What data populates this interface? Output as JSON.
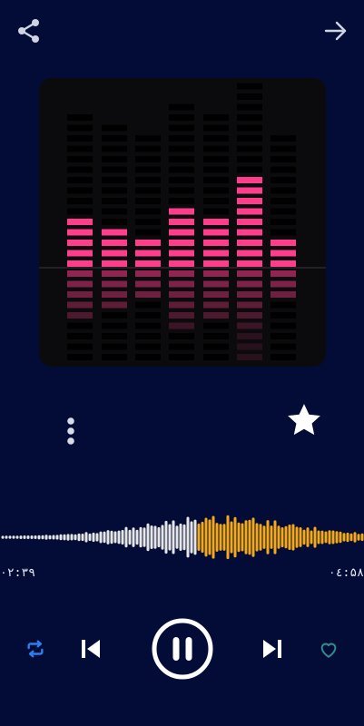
{
  "player": {
    "elapsed": "۰۲:۳۹",
    "duration": "۰٤:۵۸",
    "progress": 0.54
  },
  "icons": {
    "share": "share-icon",
    "forward": "arrow-right-icon",
    "more": "more-vertical-icon",
    "favorite": "star-icon",
    "repeat": "repeat-icon",
    "previous": "skip-previous-icon",
    "play_pause": "pause-icon",
    "next": "skip-next-icon",
    "like": "heart-icon"
  },
  "colors": {
    "background": "#030c37",
    "wave_played": "#f2a91d",
    "wave_unplayed": "#e6e6e6",
    "equalizer": "#ff3d8b",
    "accent": "#2d7ff0",
    "heart": "#2d8c8c"
  }
}
